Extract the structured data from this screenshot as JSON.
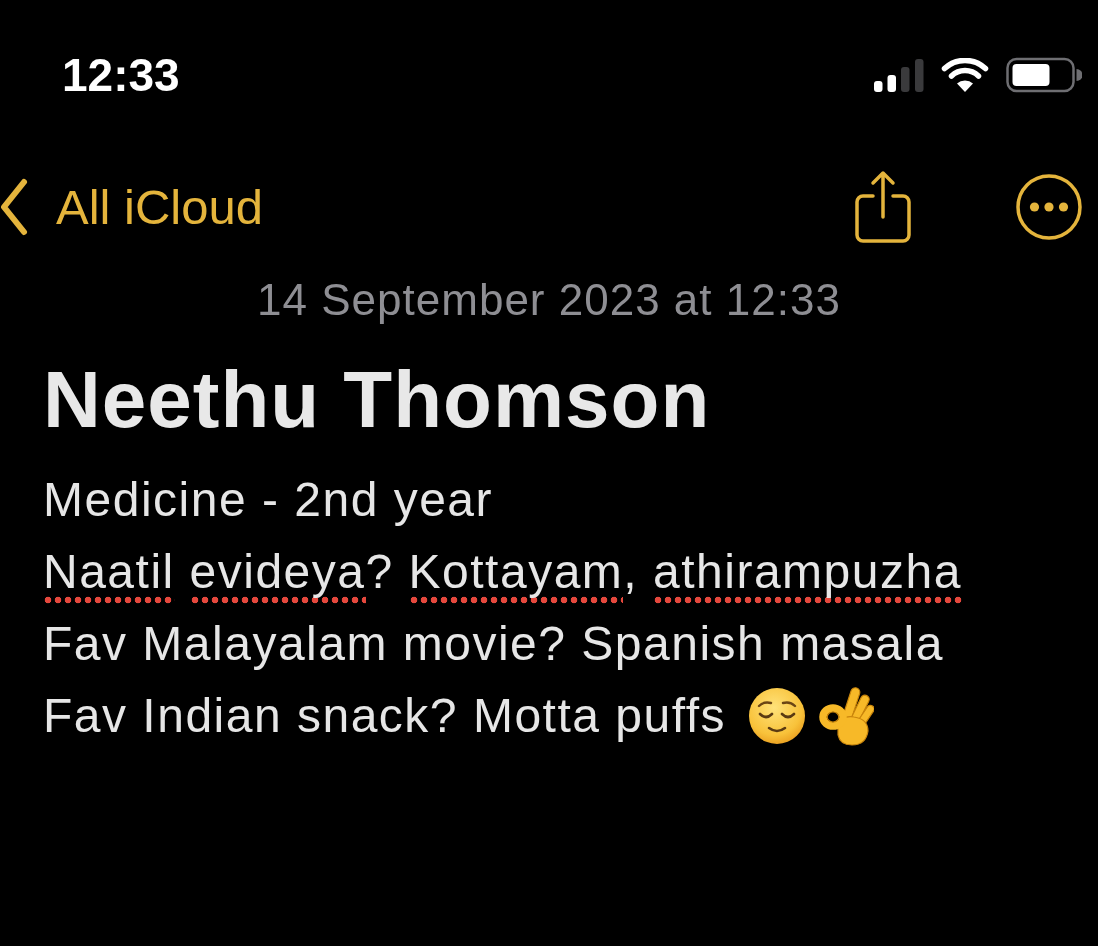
{
  "status_bar": {
    "time": "12:33"
  },
  "nav_bar": {
    "back_label": "All iCloud"
  },
  "note": {
    "date": "14 September 2023 at 12:33",
    "title": "Neethu Thomson",
    "lines": [
      {
        "words": [
          {
            "text": "Medicine - 2nd year",
            "misspelled": false
          }
        ]
      },
      {
        "words": [
          {
            "text": "Naatil",
            "misspelled": true
          },
          {
            "text": "evideya",
            "misspelled": true,
            "trail": "?"
          },
          {
            "text": "Kottayam",
            "misspelled": true,
            "trail": ","
          },
          {
            "text": "athirampuzha",
            "misspelled": true
          }
        ]
      },
      {
        "words": [
          {
            "text": "Fav Malayalam movie? Spanish masala",
            "misspelled": false
          }
        ]
      },
      {
        "words": [
          {
            "text": "Fav Indian snack? Motta puffs",
            "misspelled": false
          }
        ],
        "emoji": [
          {
            "kind": "relieved"
          },
          {
            "kind": "okhand"
          }
        ]
      }
    ]
  }
}
